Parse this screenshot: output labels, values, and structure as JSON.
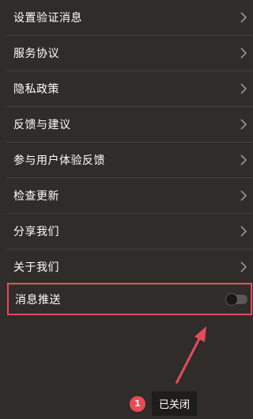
{
  "settings": {
    "items": [
      {
        "label": "设置验证消息"
      },
      {
        "label": "服务协议"
      },
      {
        "label": "隐私政策"
      },
      {
        "label": "反馈与建议"
      },
      {
        "label": "参与用户体验反馈"
      },
      {
        "label": "检查更新"
      },
      {
        "label": "分享我们"
      },
      {
        "label": "关于我们"
      }
    ],
    "push": {
      "label": "消息推送",
      "enabled": false
    }
  },
  "toast": {
    "badge": "1",
    "text": "已关闭"
  },
  "colors": {
    "background": "#2f2c2a",
    "highlight_border": "#e54b5a",
    "arrow": "#e54b5a",
    "badge": "#e94a54"
  },
  "icons": {
    "chevron": "chevron-right-icon",
    "arrow": "annotation-arrow-icon"
  }
}
